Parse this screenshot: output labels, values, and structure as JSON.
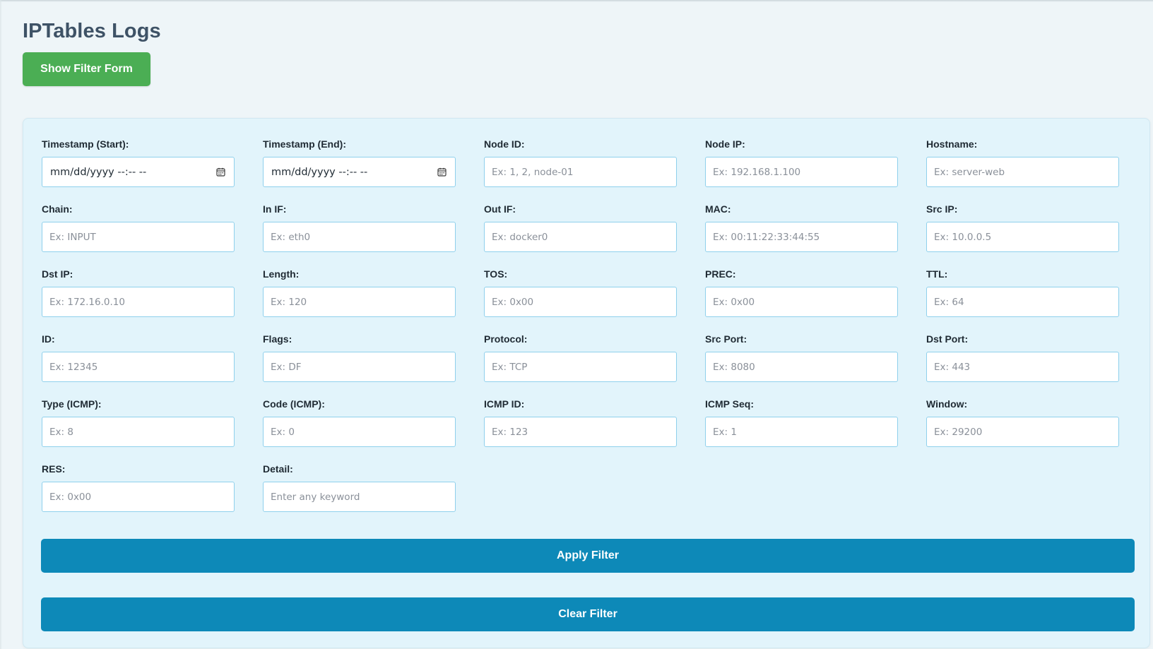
{
  "page": {
    "title": "IPTables Logs",
    "show_filter_label": "Show Filter Form"
  },
  "colors": {
    "title": "#3e5266",
    "show_filter_button": "#4bae54",
    "panel_background": "#e2f4fb",
    "action_button": "#0d89b8",
    "input_border": "#8fd0ec"
  },
  "filters": {
    "timestamp_start": {
      "label": "Timestamp (Start):",
      "value": "mm/dd/yyyy --:-- --"
    },
    "timestamp_end": {
      "label": "Timestamp (End):",
      "value": "mm/dd/yyyy --:-- --"
    },
    "node_id": {
      "label": "Node ID:",
      "placeholder": "Ex: 1, 2, node-01"
    },
    "node_ip": {
      "label": "Node IP:",
      "placeholder": "Ex: 192.168.1.100"
    },
    "hostname": {
      "label": "Hostname:",
      "placeholder": "Ex: server-web"
    },
    "chain": {
      "label": "Chain:",
      "placeholder": "Ex: INPUT"
    },
    "in_if": {
      "label": "In IF:",
      "placeholder": "Ex: eth0"
    },
    "out_if": {
      "label": "Out IF:",
      "placeholder": "Ex: docker0"
    },
    "mac": {
      "label": "MAC:",
      "placeholder": "Ex: 00:11:22:33:44:55"
    },
    "src_ip": {
      "label": "Src IP:",
      "placeholder": "Ex: 10.0.0.5"
    },
    "dst_ip": {
      "label": "Dst IP:",
      "placeholder": "Ex: 172.16.0.10"
    },
    "length": {
      "label": "Length:",
      "placeholder": "Ex: 120"
    },
    "tos": {
      "label": "TOS:",
      "placeholder": "Ex: 0x00"
    },
    "prec": {
      "label": "PREC:",
      "placeholder": "Ex: 0x00"
    },
    "ttl": {
      "label": "TTL:",
      "placeholder": "Ex: 64"
    },
    "id": {
      "label": "ID:",
      "placeholder": "Ex: 12345"
    },
    "flags": {
      "label": "Flags:",
      "placeholder": "Ex: DF"
    },
    "protocol": {
      "label": "Protocol:",
      "placeholder": "Ex: TCP"
    },
    "src_port": {
      "label": "Src Port:",
      "placeholder": "Ex: 8080"
    },
    "dst_port": {
      "label": "Dst Port:",
      "placeholder": "Ex: 443"
    },
    "type_icmp": {
      "label": "Type (ICMP):",
      "placeholder": "Ex: 8"
    },
    "code_icmp": {
      "label": "Code (ICMP):",
      "placeholder": "Ex: 0"
    },
    "icmp_id": {
      "label": "ICMP ID:",
      "placeholder": "Ex: 123"
    },
    "icmp_seq": {
      "label": "ICMP Seq:",
      "placeholder": "Ex: 1"
    },
    "window": {
      "label": "Window:",
      "placeholder": "Ex: 29200"
    },
    "res": {
      "label": "RES:",
      "placeholder": "Ex: 0x00"
    },
    "detail": {
      "label": "Detail:",
      "placeholder": "Enter any keyword"
    }
  },
  "actions": {
    "apply_label": "Apply Filter",
    "clear_label": "Clear Filter"
  }
}
